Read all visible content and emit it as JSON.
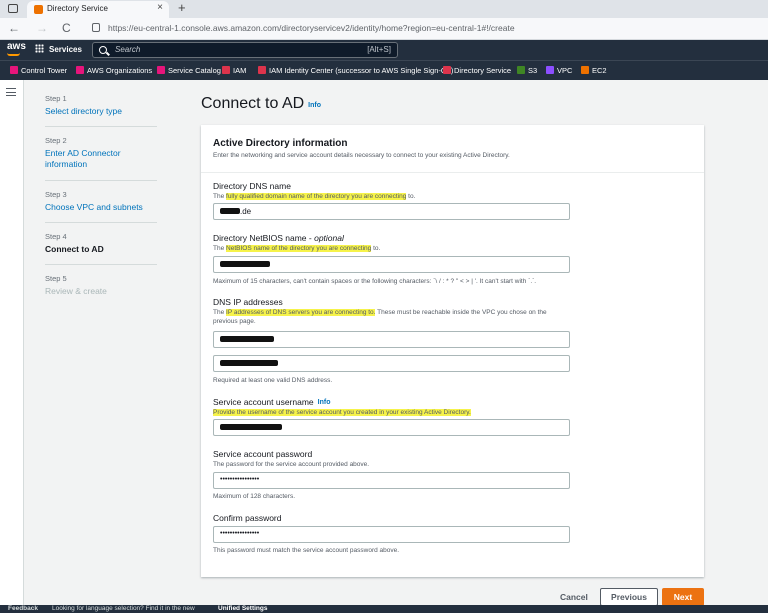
{
  "browser": {
    "tab_title": "Directory Service",
    "close_glyph": "×",
    "new_tab_glyph": "+",
    "back_glyph": "←",
    "forward_glyph": "→",
    "reload_glyph": "C",
    "url": "https://eu-central-1.console.aws.amazon.com/directoryservicev2/identity/home?region=eu-central-1#!/create"
  },
  "awsnav": {
    "logo": "aws",
    "services_label": "Services",
    "search_placeholder": "Search",
    "search_shortcut": "[Alt+S]"
  },
  "favorites": [
    {
      "label": "Control Tower",
      "color": "#e7157b"
    },
    {
      "label": "AWS Organizations",
      "color": "#e7157b"
    },
    {
      "label": "Service Catalog",
      "color": "#e7157b"
    },
    {
      "label": "IAM",
      "color": "#dd344c"
    },
    {
      "label": "IAM Identity Center (successor to AWS Single Sign-On)",
      "color": "#dd344c"
    },
    {
      "label": "Directory Service",
      "color": "#dd344c"
    },
    {
      "label": "S3",
      "color": "#3f8624"
    },
    {
      "label": "VPC",
      "color": "#8c4fff"
    },
    {
      "label": "EC2",
      "color": "#ed7100"
    }
  ],
  "steps": [
    {
      "num": "Step 1",
      "name": "Select directory type",
      "state": "link"
    },
    {
      "num": "Step 2",
      "name": "Enter AD Connector information",
      "state": "link"
    },
    {
      "num": "Step 3",
      "name": "Choose VPC and subnets",
      "state": "link"
    },
    {
      "num": "Step 4",
      "name": "Connect to AD",
      "state": "active"
    },
    {
      "num": "Step 5",
      "name": "Review & create",
      "state": "disabled"
    }
  ],
  "page": {
    "title": "Connect to AD",
    "info": "Info"
  },
  "panel": {
    "title": "Active Directory information",
    "desc": "Enter the networking and service account details necessary to connect to your existing Active Directory."
  },
  "fields": {
    "dns_name": {
      "label": "Directory DNS name",
      "desc_pre": "The ",
      "desc_hl": "fully qualified domain name of the directory you are connecting",
      "desc_post": " to.",
      "value_suffix": ".de"
    },
    "netbios": {
      "label": "Directory NetBIOS name - ",
      "label_opt": "optional",
      "desc_pre": "The ",
      "desc_hl": "NetBIOS name of the directory you are connecting",
      "desc_post": " to.",
      "constraint": "Maximum of 15 characters, can't contain spaces or the following characters: `\\ / : * ? \" < > | '. It can't start with `.`."
    },
    "dns_ips": {
      "label": "DNS IP addresses",
      "desc_pre": "The ",
      "desc_hl": "IP addresses of DNS servers you are connecting to.",
      "desc_post": " These must be reachable inside the VPC you chose on the previous page.",
      "constraint": "Required at least one valid DNS address."
    },
    "svc_user": {
      "label": "Service account username",
      "info": "Info",
      "desc_hl": "Provide the username of the service account you created in your existing Active Directory."
    },
    "svc_pass": {
      "label": "Service account password",
      "desc": "The password for the service account provided above.",
      "value": "••••••••••••••••",
      "constraint": "Maximum of 128 characters."
    },
    "confirm_pass": {
      "label": "Confirm password",
      "value": "••••••••••••••••",
      "constraint": "This password must match the service account password above."
    }
  },
  "buttons": {
    "cancel": "Cancel",
    "previous": "Previous",
    "next": "Next"
  },
  "footer": {
    "feedback": "Feedback",
    "lang_prompt": "Looking for language selection? Find it in the new",
    "unified_settings": "Unified Settings"
  }
}
